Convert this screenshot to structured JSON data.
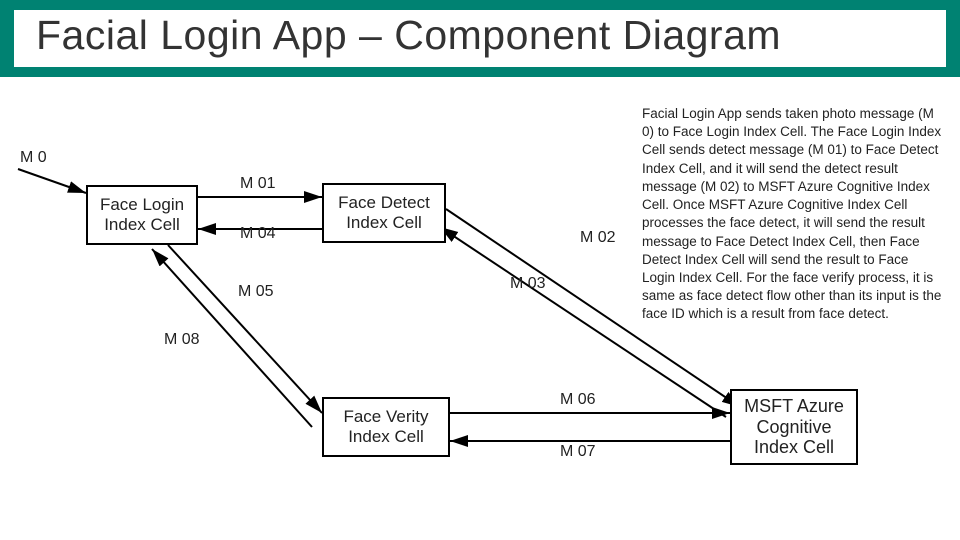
{
  "title": "Facial Login App – Component Diagram",
  "nodes": {
    "face_login": "Face Login\nIndex Cell",
    "face_detect": "Face Detect\nIndex Cell",
    "face_verity": "Face Verity\nIndex Cell",
    "msft_azure": "MSFT Azure\nCognitive\nIndex Cell"
  },
  "messages": {
    "m0": "M 0",
    "m01": "M 01",
    "m02": "M 02",
    "m03": "M 03",
    "m04": "M 04",
    "m05": "M 05",
    "m06": "M 06",
    "m07": "M 07",
    "m08": "M 08"
  },
  "description": "Facial Login App sends taken photo message (M 0) to Face Login Index Cell. The Face Login Index Cell sends detect message (M 01) to Face Detect Index Cell, and it will send the detect result message (M 02) to MSFT Azure Cognitive Index Cell. Once MSFT Azure Cognitive Index Cell processes the face detect, it will send the result message to Face Detect Index Cell, then Face Detect Index Cell will send the result to Face Login Index Cell. For the face verify process, it is same as face detect flow other than its input is the face ID which is a result from face detect."
}
